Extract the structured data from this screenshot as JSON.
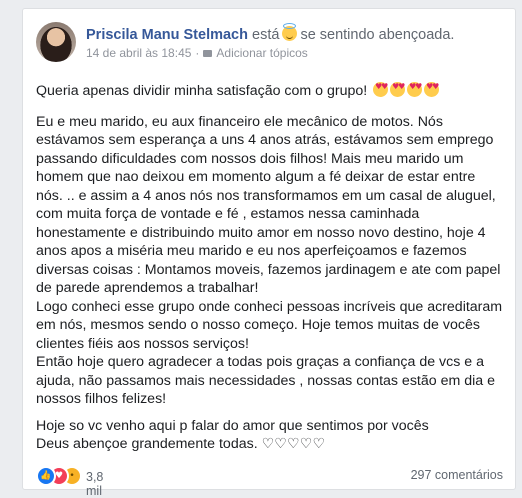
{
  "post": {
    "author": "Priscila Manu Stelmach",
    "verb_pre": "está",
    "feeling_icon": "smiling-face-with-halo-icon",
    "feeling_text": "se sentindo abençoada.",
    "date": "14 de abril às 18:45",
    "dot": "·",
    "add_topics": "Adicionar tópicos",
    "first_line": "Queria apenas dividir minha satisfação com o grupo!",
    "paragraphs": [
      "Eu e meu marido, eu aux financeiro ele mecânico de motos. Nós estávamos sem esperança a uns 4 anos atrás, estávamos sem emprego passando dificuldades com nossos dois filhos! Mais meu marido um homem que nao deixou em momento algum a fé deixar de estar entre nós. .. e assim a 4 anos nós nos transformamos em um casal de aluguel, com muita força de vontade e fé , estamos nessa caminhada honestamente e distribuindo muito amor em nosso novo destino, hoje 4 anos apos a miséria meu marido e eu nos aperfeiçoamos e fazemos diversas coisas : Montamos moveis, fazemos jardinagem e ate com papel de parede aprendemos a trabalhar!",
      "Logo conheci esse grupo onde conheci pessoas incríveis que acreditaram em nós, mesmos sendo o nosso começo. Hoje temos muitas de vocês clientes fiéis aos nossos serviços!",
      "Então hoje quero agradecer a todas pois graças a confiança de vcs e a ajuda, não passamos mais necessidades , nossas contas estão em dia e nossos filhos felizes!"
    ],
    "closing": [
      "Hoje so vc venho aqui p falar do amor que sentimos por vocês",
      "Deus abençoe grandemente todas. ♡♡♡♡♡"
    ]
  },
  "footer": {
    "reactions": [
      "like",
      "love",
      "wow"
    ],
    "reaction_count": "3,8 mil",
    "comments": "297 comentários"
  }
}
